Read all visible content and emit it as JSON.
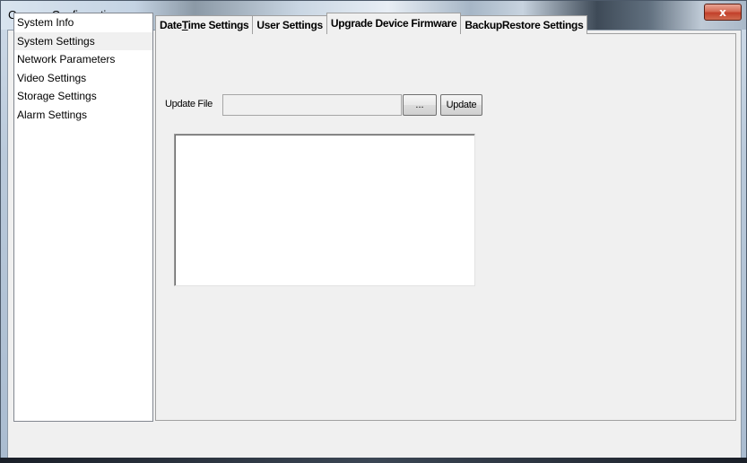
{
  "window": {
    "title": "Camera Configuration",
    "close_label": "x"
  },
  "nav": {
    "items": [
      {
        "label": "System Info"
      },
      {
        "label": "System Settings"
      },
      {
        "label": "Network Parameters"
      },
      {
        "label": "Video Settings"
      },
      {
        "label": "Storage Settings"
      },
      {
        "label": "Alarm Settings"
      }
    ],
    "selected_index": 1
  },
  "tabs": [
    {
      "label_pre": "Date",
      "label_accel": "T",
      "label_post": "ime Settings"
    },
    {
      "label": "User Settings"
    },
    {
      "label": "Upgrade Device Firmware"
    },
    {
      "label": "BackupRestore Settings"
    }
  ],
  "active_tab_index": 2,
  "firmware": {
    "update_file_label": "Update File",
    "update_file_value": "",
    "browse_label": "...",
    "update_label": "Update",
    "log_text": ""
  }
}
